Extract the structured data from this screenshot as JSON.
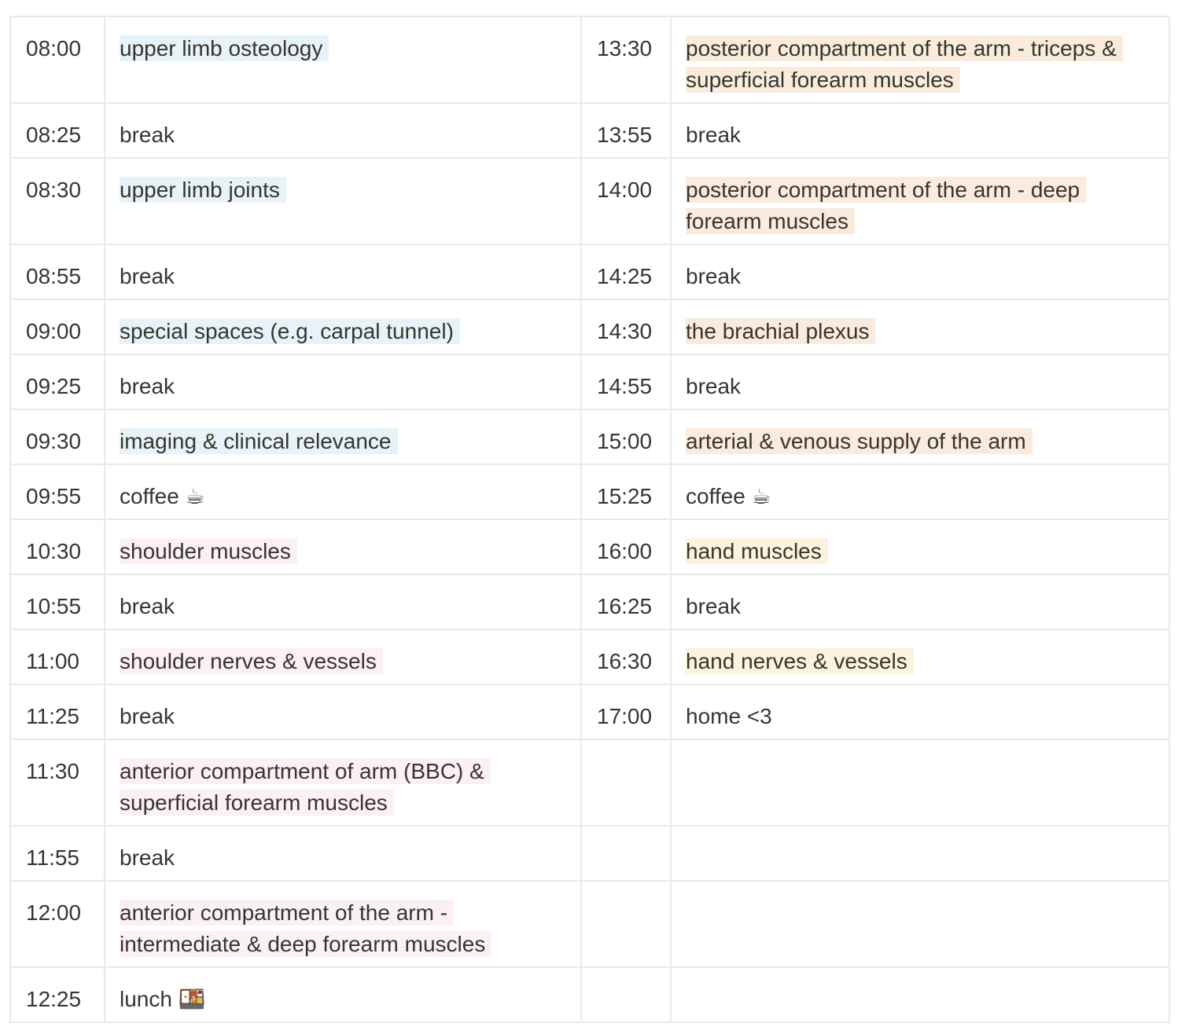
{
  "left": [
    {
      "time": "08:00",
      "text": "upper limb osteology",
      "hl": "blue"
    },
    {
      "time": "08:25",
      "text": "break",
      "hl": ""
    },
    {
      "time": "08:30",
      "text": "upper limb joints",
      "hl": "blue"
    },
    {
      "time": "08:55",
      "text": "break",
      "hl": ""
    },
    {
      "time": "09:00",
      "text": "special spaces (e.g. carpal tunnel)",
      "hl": "blue"
    },
    {
      "time": "09:25",
      "text": "break",
      "hl": ""
    },
    {
      "time": "09:30",
      "text": "imaging & clinical relevance",
      "hl": "blue"
    },
    {
      "time": "09:55",
      "text": "coffee ☕",
      "hl": ""
    },
    {
      "time": "10:30",
      "text": "shoulder muscles",
      "hl": "pink"
    },
    {
      "time": "10:55",
      "text": "break",
      "hl": ""
    },
    {
      "time": "11:00",
      "text": "shoulder nerves & vessels",
      "hl": "pink"
    },
    {
      "time": "11:25",
      "text": "break",
      "hl": ""
    },
    {
      "time": "11:30",
      "text": "anterior compartment of arm (BBC) & superficial forearm muscles",
      "hl": "pink"
    },
    {
      "time": "11:55",
      "text": "break",
      "hl": ""
    },
    {
      "time": "12:00",
      "text": "anterior compartment of the arm - intermediate & deep forearm muscles",
      "hl": "pink"
    },
    {
      "time": "12:25",
      "text": "lunch 🍱",
      "hl": ""
    }
  ],
  "right": [
    {
      "time": "13:30",
      "text": "posterior compartment of the arm - triceps & superficial forearm muscles",
      "hl": "orange"
    },
    {
      "time": "13:55",
      "text": "break",
      "hl": ""
    },
    {
      "time": "14:00",
      "text": "posterior compartment of the arm - deep forearm muscles",
      "hl": "orange"
    },
    {
      "time": "14:25",
      "text": "break",
      "hl": ""
    },
    {
      "time": "14:30",
      "text": "the brachial plexus",
      "hl": "orange"
    },
    {
      "time": "14:55",
      "text": "break",
      "hl": ""
    },
    {
      "time": "15:00",
      "text": "arterial & venous supply of the arm",
      "hl": "orange"
    },
    {
      "time": "15:25",
      "text": "coffee ☕",
      "hl": ""
    },
    {
      "time": "16:00",
      "text": "hand muscles",
      "hl": "yellow"
    },
    {
      "time": "16:25",
      "text": "break",
      "hl": ""
    },
    {
      "time": "16:30",
      "text": "hand nerves & vessels",
      "hl": "yellow"
    },
    {
      "time": "17:00",
      "text": "home <3",
      "hl": ""
    },
    {
      "time": "",
      "text": "",
      "hl": ""
    },
    {
      "time": "",
      "text": "",
      "hl": ""
    },
    {
      "time": "",
      "text": "",
      "hl": ""
    },
    {
      "time": "",
      "text": "",
      "hl": ""
    }
  ],
  "colors": {
    "blue": "#e7f3f8",
    "pink": "#fbf0f5",
    "orange": "#faebdd",
    "yellow": "#fbf3db",
    "border": "#e9e9e7",
    "text": "#37352f"
  }
}
